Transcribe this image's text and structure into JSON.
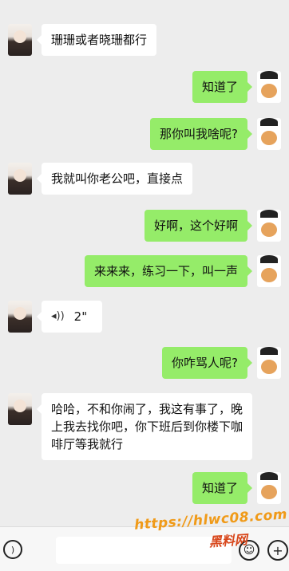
{
  "messages": [
    {
      "side": "left",
      "text": "珊珊或者晓珊都行"
    },
    {
      "side": "right",
      "text": "知道了"
    },
    {
      "side": "right",
      "text": "那你叫我啥呢?"
    },
    {
      "side": "left",
      "text": "我就叫你老公吧，直接点"
    },
    {
      "side": "right",
      "text": "好啊，这个好啊"
    },
    {
      "side": "right",
      "text": "来来来，练习一下，叫一声"
    },
    {
      "side": "left",
      "voice": true,
      "duration": "2\""
    },
    {
      "side": "right",
      "text": "你咋骂人呢?"
    },
    {
      "side": "left",
      "text": "哈哈，不和你闹了，我这有事了，晚上我去找你吧，你下班后到你楼下咖啡厅等我就行"
    },
    {
      "side": "right",
      "text": "知道了"
    }
  ],
  "icons": {
    "voice_toggle": "voice-icon",
    "emoji": "emoji-icon",
    "more": "plus-icon",
    "voice_wave": "sound-wave-icon"
  },
  "watermark": {
    "url": "https://hlwc08.com",
    "name": "黑料网"
  },
  "colors": {
    "background": "#ededed",
    "bubble_self": "#95ec69",
    "bubble_other": "#ffffff"
  }
}
